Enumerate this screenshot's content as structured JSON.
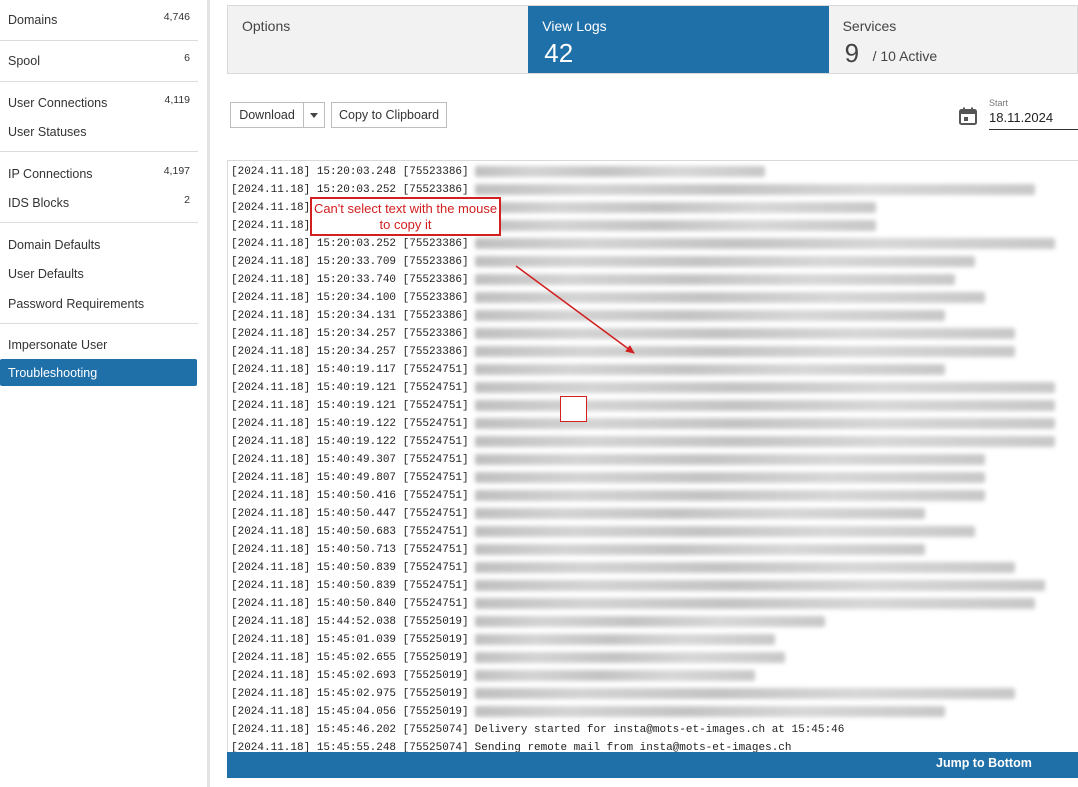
{
  "sidebar": {
    "groups": [
      [
        {
          "label": "Domains",
          "count": "4,746",
          "active": false
        }
      ],
      [
        {
          "label": "Spool",
          "count": "6",
          "active": false
        }
      ],
      [
        {
          "label": "User Connections",
          "count": "4,119",
          "active": false
        },
        {
          "label": "User Statuses",
          "count": "",
          "active": false
        }
      ],
      [
        {
          "label": "IP Connections",
          "count": "4,197",
          "active": false
        },
        {
          "label": "IDS Blocks",
          "count": "2",
          "active": false
        }
      ],
      [
        {
          "label": "Domain Defaults",
          "count": "",
          "active": false
        },
        {
          "label": "User Defaults",
          "count": "",
          "active": false
        },
        {
          "label": "Password Requirements",
          "count": "",
          "active": false
        }
      ],
      [
        {
          "label": "Impersonate User",
          "count": "",
          "active": false
        }
      ]
    ],
    "active_item": "Troubleshooting"
  },
  "tabs": {
    "options": {
      "title": "Options"
    },
    "view_logs": {
      "title": "View Logs",
      "number": "42"
    },
    "services": {
      "title": "Services",
      "number": "9",
      "sub": "/ 10 Active"
    }
  },
  "toolbar": {
    "download_label": "Download",
    "copy_label": "Copy to Clipboard",
    "start_label": "Start",
    "start_value": "18.11.2024"
  },
  "log_lines": [
    {
      "ts": "[2024.11.18] 15:20:03.248 [75523386]",
      "msg": ""
    },
    {
      "ts": "[2024.11.18] 15:20:03.252 [75523386]",
      "msg": ""
    },
    {
      "ts": "[2024.11.18]",
      "msg": ""
    },
    {
      "ts": "[2024.11.18]",
      "msg": ""
    },
    {
      "ts": "[2024.11.18] 15:20:03.252 [75523386]",
      "msg": ""
    },
    {
      "ts": "[2024.11.18] 15:20:33.709 [75523386]",
      "msg": ""
    },
    {
      "ts": "[2024.11.18] 15:20:33.740 [75523386]",
      "msg": ""
    },
    {
      "ts": "[2024.11.18] 15:20:34.100 [75523386]",
      "msg": ""
    },
    {
      "ts": "[2024.11.18] 15:20:34.131 [75523386]",
      "msg": ""
    },
    {
      "ts": "[2024.11.18] 15:20:34.257 [75523386]",
      "msg": ""
    },
    {
      "ts": "[2024.11.18] 15:20:34.257 [75523386]",
      "msg": ""
    },
    {
      "ts": "[2024.11.18] 15:40:19.117 [75524751]",
      "msg": ""
    },
    {
      "ts": "[2024.11.18] 15:40:19.121 [75524751]",
      "msg": ""
    },
    {
      "ts": "[2024.11.18] 15:40:19.121 [75524751]",
      "msg": ""
    },
    {
      "ts": "[2024.11.18] 15:40:19.122 [75524751]",
      "msg": ""
    },
    {
      "ts": "[2024.11.18] 15:40:19.122 [75524751]",
      "msg": ""
    },
    {
      "ts": "[2024.11.18] 15:40:49.307 [75524751]",
      "msg": ""
    },
    {
      "ts": "[2024.11.18] 15:40:49.807 [75524751]",
      "msg": ""
    },
    {
      "ts": "[2024.11.18] 15:40:50.416 [75524751]",
      "msg": ""
    },
    {
      "ts": "[2024.11.18] 15:40:50.447 [75524751]",
      "msg": ""
    },
    {
      "ts": "[2024.11.18] 15:40:50.683 [75524751]",
      "msg": ""
    },
    {
      "ts": "[2024.11.18] 15:40:50.713 [75524751]",
      "msg": ""
    },
    {
      "ts": "[2024.11.18] 15:40:50.839 [75524751]",
      "msg": ""
    },
    {
      "ts": "[2024.11.18] 15:40:50.839 [75524751]",
      "msg": ""
    },
    {
      "ts": "[2024.11.18] 15:40:50.840 [75524751]",
      "msg": ""
    },
    {
      "ts": "[2024.11.18] 15:44:52.038 [75525019]",
      "msg": ""
    },
    {
      "ts": "[2024.11.18] 15:45:01.039 [75525019]",
      "msg": ""
    },
    {
      "ts": "[2024.11.18] 15:45:02.655 [75525019]",
      "msg": ""
    },
    {
      "ts": "[2024.11.18] 15:45:02.693 [75525019]",
      "msg": ""
    },
    {
      "ts": "[2024.11.18] 15:45:02.975 [75525019]",
      "msg": ""
    },
    {
      "ts": "[2024.11.18] 15:45:04.056 [75525019]",
      "msg": ""
    },
    {
      "ts": "[2024.11.18] 15:45:46.202 [75525074]",
      "msg": "Delivery started for insta@mots-et-images.ch at 15:45:46"
    },
    {
      "ts": "[2024.11.18] 15:45:55.248 [75525074]",
      "msg": "Sending remote mail from insta@mots-et-images.ch"
    }
  ],
  "footer": {
    "jump_label": "Jump to Bottom"
  },
  "annotation": {
    "callout_text": "Can't select text with the mouse to copy it"
  },
  "colors": {
    "accent": "#1f6fa8",
    "annotation": "#d21f1f"
  }
}
